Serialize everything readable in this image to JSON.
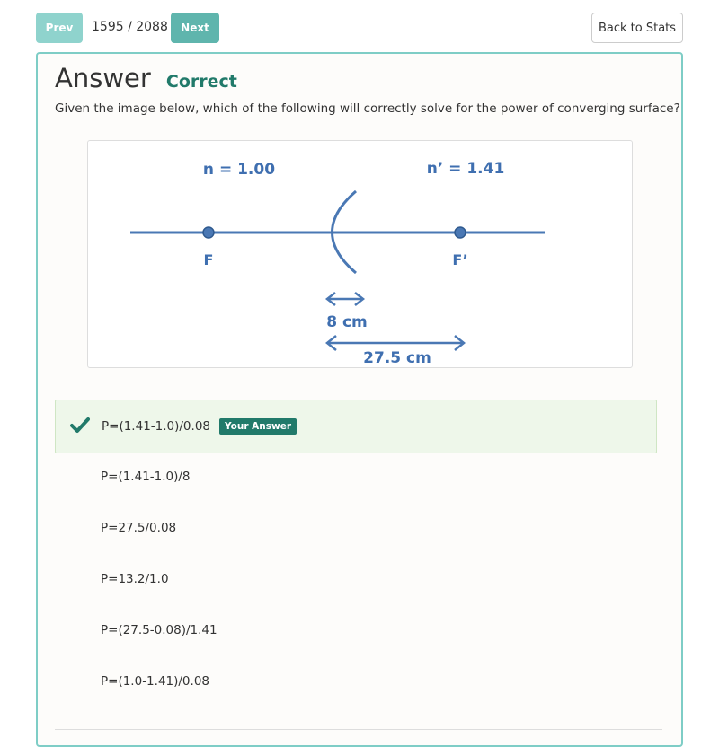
{
  "nav": {
    "prev_label": "Prev",
    "counter": "1595 / 2088",
    "next_label": "Next",
    "back_label": "Back to Stats"
  },
  "answer": {
    "title": "Answer",
    "status": "Correct",
    "question": "Given the image below, which of the following will correctly solve for the power of converging surface?"
  },
  "diagram": {
    "n_left": "n = 1.00",
    "n_right": "n’ = 1.41",
    "focal_left": "F",
    "focal_right": "F’",
    "dist_short": "8 cm",
    "dist_long": "27.5 cm"
  },
  "options": [
    {
      "text": "P=(1.41-1.0)/0.08",
      "selected": true,
      "badge": "Your Answer"
    },
    {
      "text": "P=(1.41-1.0)/8"
    },
    {
      "text": "P=27.5/0.08"
    },
    {
      "text": "P=13.2/1.0"
    },
    {
      "text": "P=(27.5-0.08)/1.41"
    },
    {
      "text": "P=(1.0-1.41)/0.08"
    }
  ],
  "colors": {
    "accent": "#5fb5ad",
    "correct": "#217a6a",
    "diagram_blue": "#4a78b4"
  }
}
